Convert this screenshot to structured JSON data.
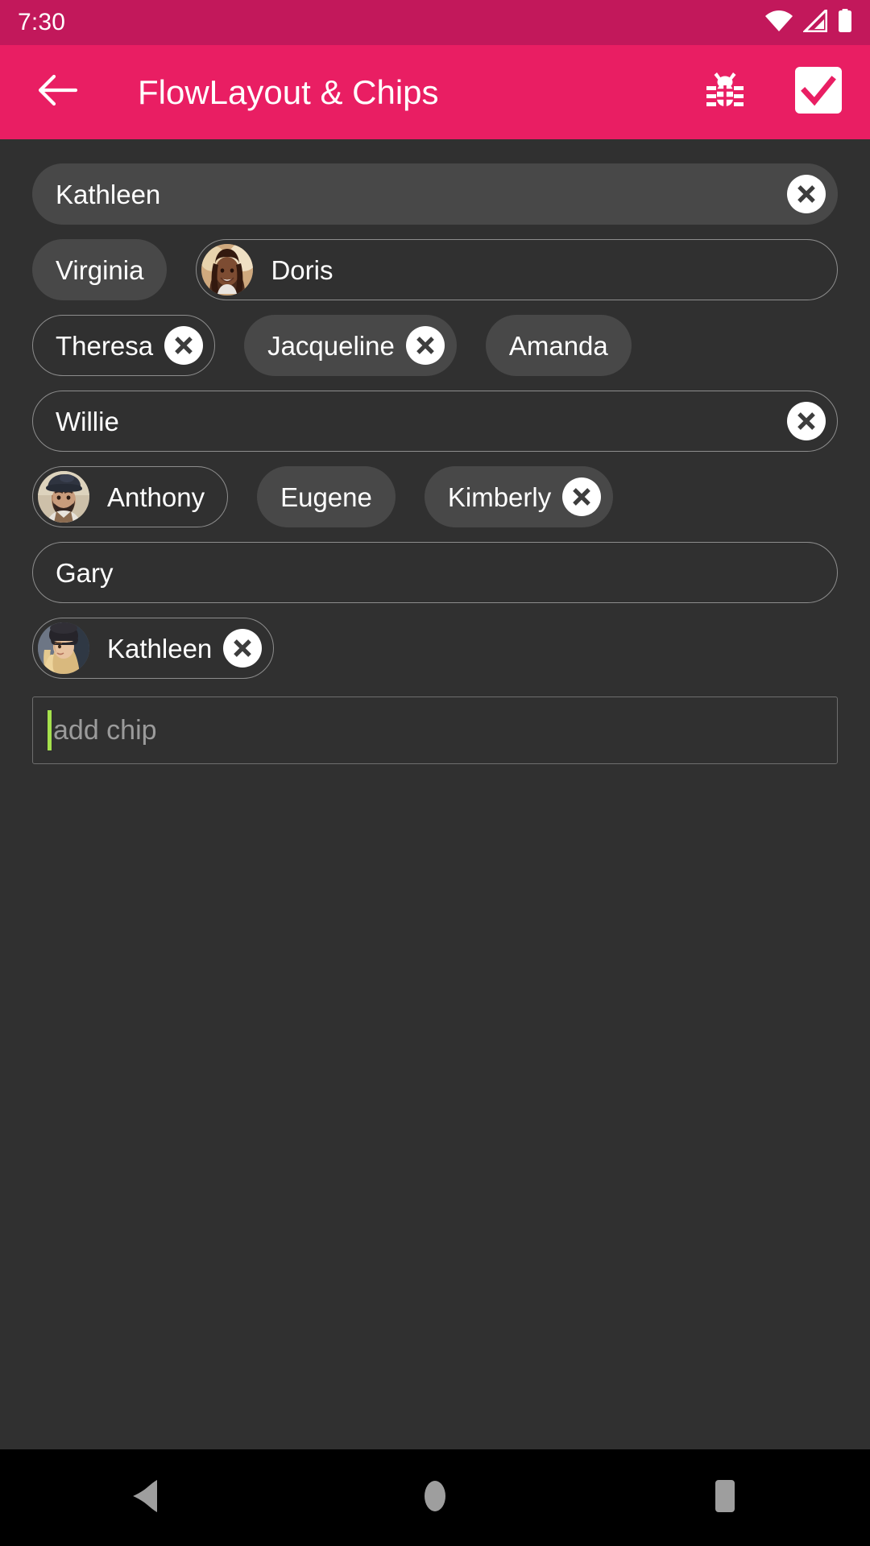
{
  "status_bar": {
    "time": "7:30",
    "icons": [
      "wifi-icon",
      "cellular-signal-icon",
      "battery-icon"
    ],
    "background_color": "#C2185B"
  },
  "app_bar": {
    "title": "FlowLayout & Chips",
    "background_color": "#E91E63",
    "back_label": "Back",
    "actions": [
      {
        "name": "debug-action",
        "icon": "bug-icon",
        "label": "Debug"
      },
      {
        "name": "select-all-action",
        "icon": "checkbox-checked-icon",
        "label": "Select all"
      }
    ]
  },
  "content": {
    "background_color": "#303030",
    "chip_fill_color": "#484848",
    "chip_outline_color": "#8d8d8d",
    "rows": [
      {
        "chips": [
          {
            "label": "Kathleen",
            "style": "filled",
            "avatar": null,
            "close": true,
            "full_width": true
          }
        ]
      },
      {
        "chips": [
          {
            "label": "Virginia",
            "style": "filled",
            "avatar": null,
            "close": false,
            "full_width": false
          },
          {
            "label": "Doris",
            "style": "outlined",
            "avatar": "woman-smiling-braids",
            "close": false,
            "full_width": true
          }
        ]
      },
      {
        "chips": [
          {
            "label": "Theresa",
            "style": "outlined",
            "avatar": null,
            "close": true,
            "full_width": false
          },
          {
            "label": "Jacqueline",
            "style": "filled",
            "avatar": null,
            "close": true,
            "full_width": false
          },
          {
            "label": "Amanda",
            "style": "filled",
            "avatar": null,
            "close": false,
            "full_width": false
          }
        ]
      },
      {
        "chips": [
          {
            "label": "Willie",
            "style": "outlined",
            "avatar": null,
            "close": true,
            "full_width": true
          }
        ]
      },
      {
        "chips": [
          {
            "label": "Anthony",
            "style": "outlined",
            "avatar": "man-flat-cap-beard",
            "close": false,
            "full_width": false
          },
          {
            "label": "Eugene",
            "style": "filled",
            "avatar": null,
            "close": false,
            "full_width": false
          },
          {
            "label": "Kimberly",
            "style": "filled",
            "avatar": null,
            "close": true,
            "full_width": false
          }
        ]
      },
      {
        "chips": [
          {
            "label": "Gary",
            "style": "outlined",
            "avatar": null,
            "close": false,
            "full_width": true
          }
        ]
      },
      {
        "chips": [
          {
            "label": "Kathleen",
            "style": "outlined",
            "avatar": "woman-beanie-blonde",
            "close": true,
            "full_width": false
          }
        ]
      }
    ]
  },
  "add_chip_field": {
    "value": "",
    "placeholder": "add chip",
    "caret_color": "#A5E14C"
  },
  "nav_bar": {
    "background_color": "#000000",
    "buttons": [
      {
        "name": "nav-back-button",
        "icon": "triangle-back-icon",
        "label": "Back"
      },
      {
        "name": "nav-home-button",
        "icon": "circle-home-icon",
        "label": "Home"
      },
      {
        "name": "nav-recents-button",
        "icon": "square-recents-icon",
        "label": "Recents"
      }
    ]
  }
}
